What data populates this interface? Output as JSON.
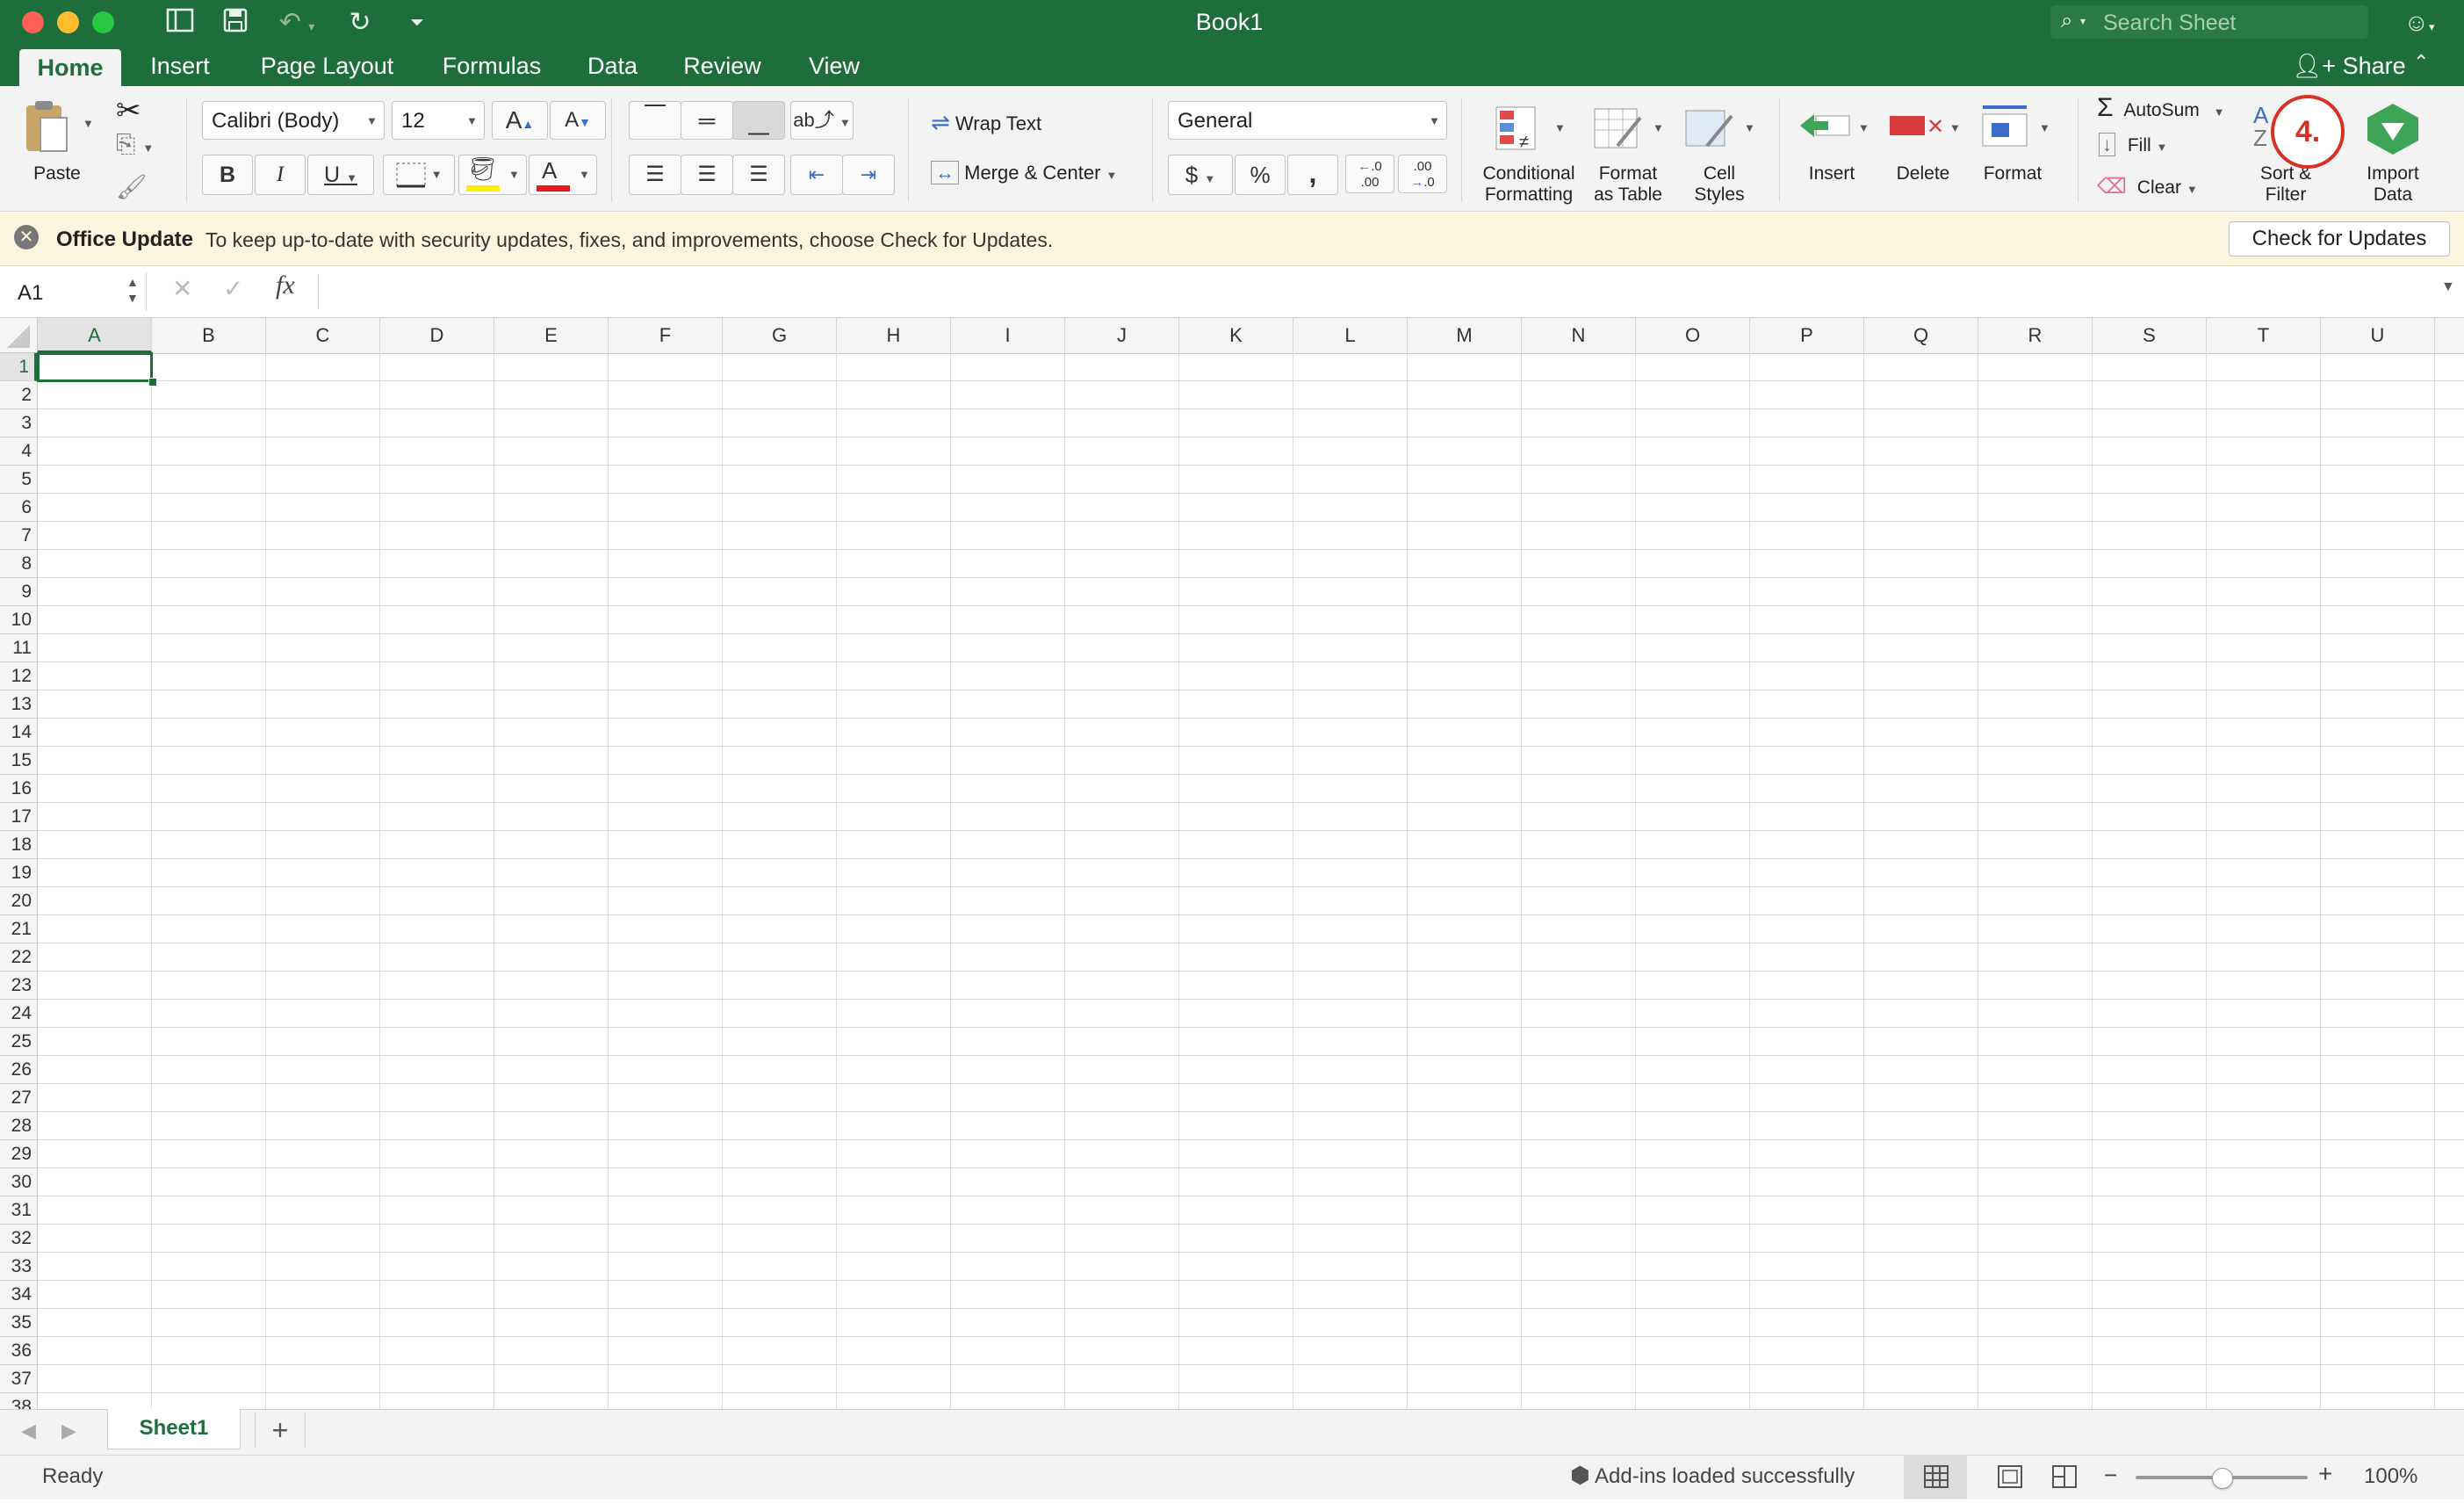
{
  "window": {
    "title": "Book1"
  },
  "search": {
    "placeholder": "Search Sheet"
  },
  "share": {
    "label": "Share"
  },
  "tabs": [
    "Home",
    "Insert",
    "Page Layout",
    "Formulas",
    "Data",
    "Review",
    "View"
  ],
  "ribbon": {
    "paste": "Paste",
    "font_name": "Calibri (Body)",
    "font_size": "12",
    "bold": "B",
    "italic": "I",
    "underline": "U",
    "wrap_text": "Wrap Text",
    "merge_center": "Merge & Center",
    "number_format": "General",
    "currency": "$",
    "percent": "%",
    "comma": ",",
    "conditional_formatting": [
      "Conditional",
      "Formatting"
    ],
    "format_as_table": [
      "Format",
      "as Table"
    ],
    "cell_styles": [
      "Cell",
      "Styles"
    ],
    "insert": "Insert",
    "delete": "Delete",
    "format": "Format",
    "autosum": "AutoSum",
    "fill": "Fill",
    "clear": "Clear",
    "sort_filter": [
      "Sort &",
      "Filter"
    ],
    "import_data": [
      "Import",
      "Data"
    ],
    "step_badge": "4."
  },
  "update_bar": {
    "title": "Office Update",
    "message": "To keep up-to-date with security updates, fixes, and improvements, choose Check for Updates.",
    "button": "Check for Updates"
  },
  "formula_bar": {
    "name_box": "A1",
    "fx": "fx",
    "value": ""
  },
  "grid": {
    "columns": [
      "A",
      "B",
      "C",
      "D",
      "E",
      "F",
      "G",
      "H",
      "I",
      "J",
      "K",
      "L",
      "M",
      "N",
      "O",
      "P",
      "Q",
      "R",
      "S",
      "T",
      "U"
    ],
    "rows": [
      "1",
      "2",
      "3",
      "4",
      "5",
      "6",
      "7",
      "8",
      "9",
      "10",
      "11",
      "12",
      "13",
      "14",
      "15",
      "16",
      "17",
      "18",
      "19",
      "20",
      "21",
      "22",
      "23",
      "24",
      "25",
      "26",
      "27",
      "28",
      "29",
      "30",
      "31",
      "32",
      "33",
      "34",
      "35",
      "36",
      "37",
      "38"
    ],
    "selected": "A1"
  },
  "sheets": {
    "tabs": [
      "Sheet1"
    ],
    "active": "Sheet1",
    "add": "+"
  },
  "status": {
    "left": "Ready",
    "addins": "Add-ins loaded successfully",
    "zoom": "100%",
    "zoom_level": 0.5
  },
  "colors": {
    "accent": "#1e6e3c",
    "badge": "#d93025",
    "selection": "#1e6e3c"
  }
}
